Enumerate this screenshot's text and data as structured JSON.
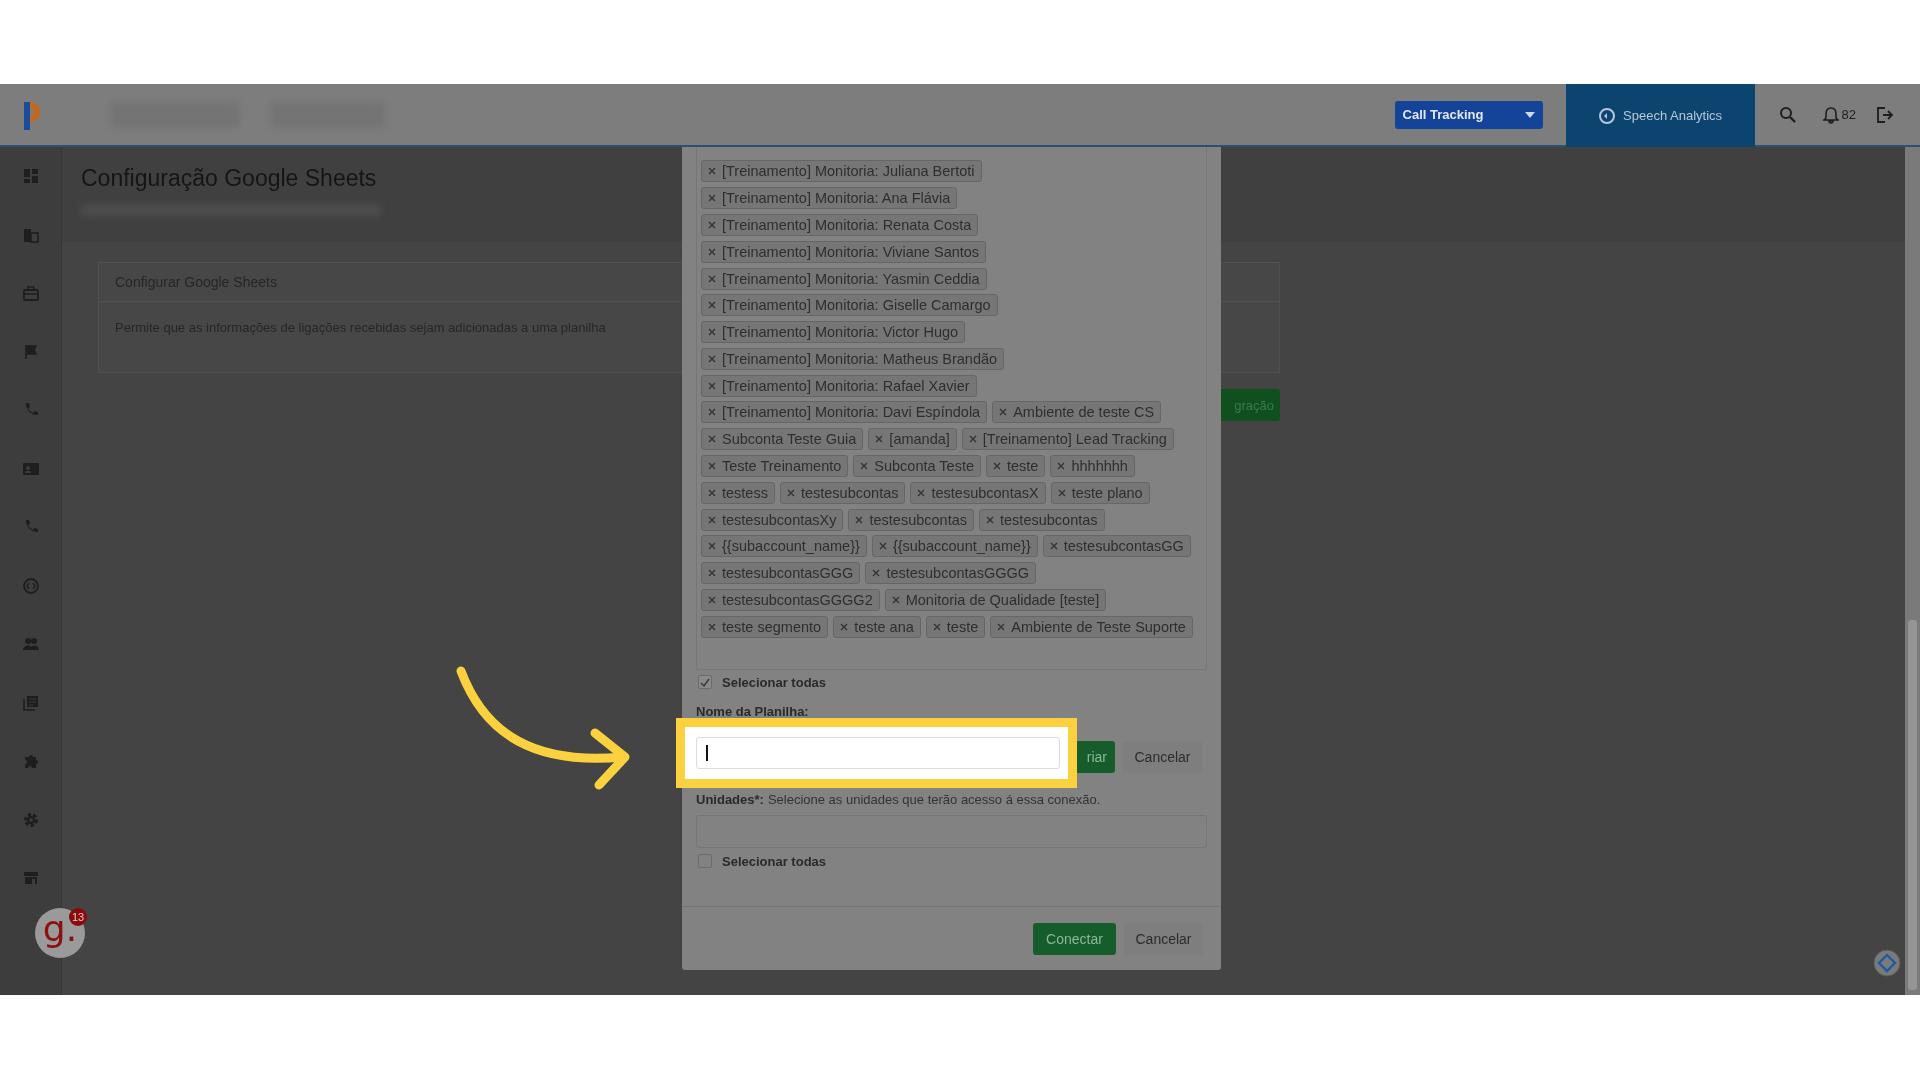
{
  "header": {
    "app_menu": {
      "label": "Call Tracking"
    },
    "product": {
      "label": "Speech Analytics"
    },
    "notifications": {
      "count": "82"
    }
  },
  "page": {
    "title": "Configuração Google Sheets",
    "card": {
      "title": "Configurar Google Sheets",
      "description": "Permite que as informações de ligações recebidas sejam adicionadas a uma planilha"
    },
    "action_button": {
      "label": "gração"
    }
  },
  "modal": {
    "tags": [
      "[Treinamento] Monitoria: Juliana Bertoti",
      "[Treinamento] Monitoria: Ana Flávia",
      "[Treinamento] Monitoria: Renata Costa",
      "[Treinamento] Monitoria: Viviane Santos",
      "[Treinamento] Monitoria: Yasmin Ceddia",
      "[Treinamento] Monitoria: Giselle Camargo",
      "[Treinamento] Monitoria: Victor Hugo",
      "[Treinamento] Monitoria: Matheus Brandão",
      "[Treinamento] Monitoria: Rafael Xavier",
      "[Treinamento] Monitoria: Davi Espíndola",
      "Ambiente de teste CS",
      "Subconta Teste Guia",
      "[amanda]",
      "[Treinamento] Lead Tracking",
      "Teste Treinamento",
      "Subconta Teste",
      "teste",
      "hhhhhhh",
      "testess",
      "testesubcontas",
      "testesubcontasX",
      "teste plano",
      "testesubcontasXy",
      "testesubcontas",
      "testesubcontas",
      "{{subaccount_name}}",
      "{{subaccount_name}}",
      "testesubcontasGG",
      "testesubcontasGGG",
      "testesubcontasGGGG",
      "testesubcontasGGGG2",
      "Monitoria de Qualidade [teste]",
      "teste segmento",
      "teste ana",
      "teste",
      "Ambiente de Teste Suporte"
    ],
    "select_all_accounts": {
      "label": "Selecionar todas",
      "checked": true
    },
    "sheet_name": {
      "label": "Nome da Planilha:",
      "create_button": "riar",
      "cancel_button": "Cancelar"
    },
    "units": {
      "label": "Unidades*:",
      "hint": "Selecione as unidades que terão acesso á essa conexão."
    },
    "select_all_units": {
      "label": "Selecionar todas",
      "checked": false
    },
    "footer": {
      "connect_button": "Conectar",
      "cancel_button": "Cancelar"
    }
  },
  "assistant": {
    "letter": "g.",
    "badge": "13"
  }
}
